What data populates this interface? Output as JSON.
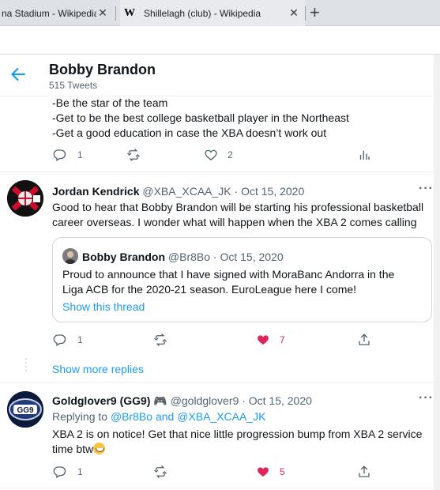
{
  "browser": {
    "tabs": [
      {
        "title": "na Stadium - Wikipedia",
        "close": "✕"
      },
      {
        "title": "Shillelagh (club) - Wikipedia",
        "favicon": "W",
        "close": "✕"
      }
    ],
    "new_tab": "+"
  },
  "header": {
    "name": "Bobby Brandon",
    "tweet_count": "515 Tweets",
    "back_icon": "arrow-left-icon"
  },
  "colors": {
    "accent": "#1d9bf0",
    "like": "#e0245e",
    "muted": "#536471"
  },
  "tweets": [
    {
      "lines": [
        "-Be the star of the team",
        "-Get to be the best college basketball player in the Northeast",
        "-Get a good education in case the XBA doesn’t work out"
      ],
      "actions": {
        "replies": "1",
        "retweets": "",
        "likes": "2"
      }
    },
    {
      "display_name": "Jordan Kendrick",
      "handle": "@XBA_XCAA_JK",
      "sep": "·",
      "date": "Oct 15, 2020",
      "lines": [
        "Good to hear that Bobby Brandon will be starting his professional basketball",
        "career overseas. I wonder what will happen when the XBA 2 comes calling"
      ],
      "quote": {
        "display_name": "Bobby Brandon",
        "handle": "@Br8Bo",
        "sep": "·",
        "date": "Oct 15, 2020",
        "lines": [
          "Proud to announce that I have signed with MoraBanc Andorra in the",
          "Liga ACB for the 2020-21 season. EuroLeague here I come!"
        ],
        "show_thread": "Show this thread"
      },
      "actions": {
        "replies": "1",
        "retweets": "",
        "likes": "7",
        "liked": true
      }
    },
    {
      "display_name": "Goldglover9 (GG9) 🎮",
      "handle": "@goldglover9",
      "sep": "·",
      "date": "Oct 15, 2020",
      "replying_prefix": "Replying to",
      "replying_to": "@Br8Bo and @XBA_XCAA_JK",
      "line1": "XBA 2 is on notice! Get that nice little progression bump from XBA 2 service",
      "line2": "time btw",
      "actions": {
        "replies": "1",
        "retweets": "",
        "likes": "5",
        "liked": true
      }
    }
  ],
  "show_more_replies": "Show more replies"
}
